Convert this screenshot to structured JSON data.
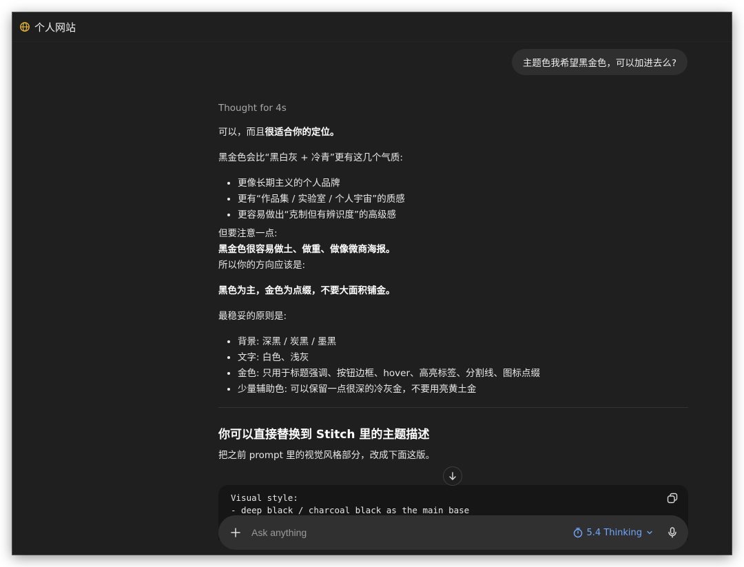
{
  "header": {
    "title": "个人网站",
    "accent_color": "#e8b62a"
  },
  "user_message": "主题色我希望黑金色，可以加进去么?",
  "assistant": {
    "thought": "Thought for 4s",
    "p1_prefix": "可以，而且",
    "p1_bold": "很适合你的定位。",
    "p2": "黑金色会比“黑白灰 + 冷青”更有这几个气质:",
    "list1": [
      "更像长期主义的个人品牌",
      "更有“作品集 / 实验室 / 个人宇宙”的质感",
      "更容易做出“克制但有辨识度”的高级感"
    ],
    "p3": "但要注意一点:",
    "p4_bold": "黑金色很容易做土、做重、做像微商海报。",
    "p5": "所以你的方向应该是:",
    "p6_bold": "黑色为主，金色为点缀，不要大面积铺金。",
    "p7": "最稳妥的原则是:",
    "list2": [
      "背景: 深黑 / 炭黑 / 墨黑",
      "文字: 白色、浅灰",
      "金色: 只用于标题强调、按钮边框、hover、高亮标签、分割线、图标点缀",
      "少量辅助色: 可以保留一点很深的冷灰金，不要用亮黄土金"
    ],
    "heading": "你可以直接替换到 Stitch 里的主题描述",
    "p8": "把之前 prompt 里的视觉风格部分，改成下面这版。",
    "code_lines": [
      "Visual style:",
      "- deep black / charcoal black as the main base"
    ]
  },
  "composer": {
    "placeholder": "Ask anything",
    "model_label": "5.4 Thinking",
    "model_color": "#6ea8ff"
  }
}
